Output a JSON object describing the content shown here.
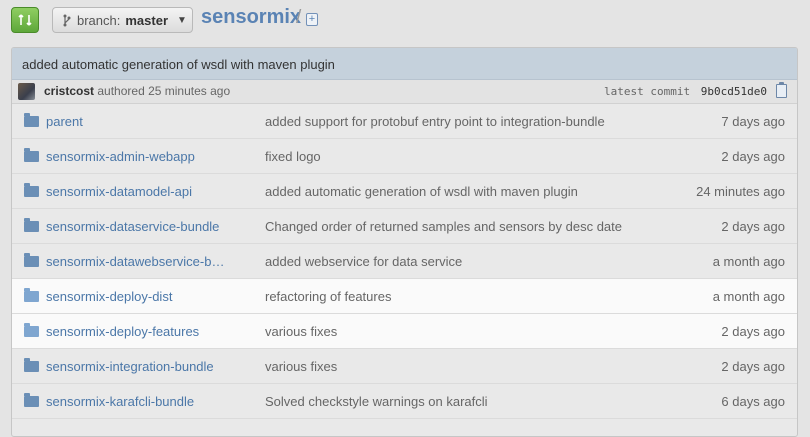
{
  "branch": {
    "label": "branch:",
    "value": "master"
  },
  "repo": {
    "name": "sensormix",
    "separator": "/"
  },
  "commit": {
    "message": "added automatic generation of wsdl with maven plugin",
    "author": "cristcost",
    "authored_text": "authored 25 minutes ago",
    "latest_label": "latest commit",
    "sha": "9b0cd51de0"
  },
  "files": [
    {
      "name": "parent",
      "message": "added support for protobuf entry point to integration-bundle",
      "age": "7 days ago"
    },
    {
      "name": "sensormix-admin-webapp",
      "message": "fixed logo",
      "age": "2 days ago"
    },
    {
      "name": "sensormix-datamodel-api",
      "message": "added automatic generation of wsdl with maven plugin",
      "age": "24 minutes ago"
    },
    {
      "name": "sensormix-dataservice-bundle",
      "message": "Changed order of returned samples and sensors by desc date",
      "age": "2 days ago"
    },
    {
      "name": "sensormix-datawebservice-b…",
      "message": "added webservice for data service",
      "age": "a month ago"
    },
    {
      "name": "sensormix-deploy-dist",
      "message": "refactoring of features",
      "age": "a month ago"
    },
    {
      "name": "sensormix-deploy-features",
      "message": "various fixes",
      "age": "2 days ago"
    },
    {
      "name": "sensormix-integration-bundle",
      "message": "various fixes",
      "age": "2 days ago"
    },
    {
      "name": "sensormix-karafcli-bundle",
      "message": "Solved checkstyle warnings on karafcli",
      "age": "6 days ago"
    }
  ],
  "icons": {
    "compare": "compare-icon",
    "branch": "branch-icon",
    "caret": "caret-down-icon",
    "new_file": "new-file-icon",
    "clipboard": "clipboard-icon",
    "folder": "folder-icon"
  },
  "colors": {
    "link": "#4b77a8",
    "compare_green": "#6cb245",
    "commit_bar": "#c5d1dc"
  }
}
